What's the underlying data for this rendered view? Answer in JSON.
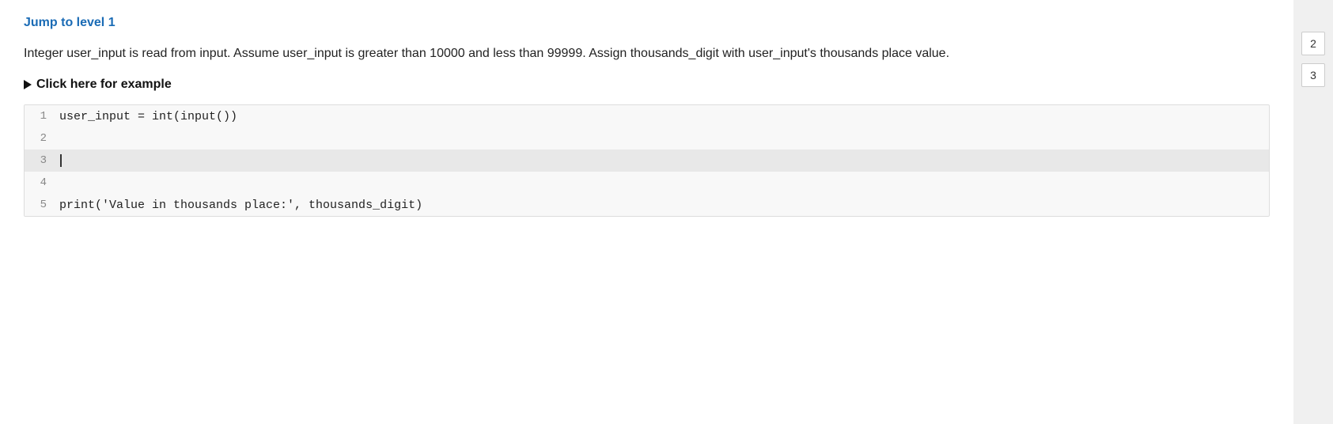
{
  "header": {
    "jump_label": "Jump to level 1"
  },
  "description": {
    "text": "Integer user_input is read from input. Assume user_input is greater than 10000 and less than 99999. Assign thousands_digit with user_input's thousands place value."
  },
  "example": {
    "label": "Click here for example"
  },
  "code": {
    "lines": [
      {
        "number": "1",
        "content": "user_input = int(input())",
        "highlighted": false
      },
      {
        "number": "2",
        "content": "",
        "highlighted": false
      },
      {
        "number": "3",
        "content": "",
        "highlighted": true,
        "cursor": true
      },
      {
        "number": "4",
        "content": "",
        "highlighted": false
      },
      {
        "number": "5",
        "content": "print('Value in thousands place:', thousands_digit)",
        "highlighted": false
      }
    ]
  },
  "sidebar": {
    "numbers": [
      "2",
      "3"
    ]
  }
}
